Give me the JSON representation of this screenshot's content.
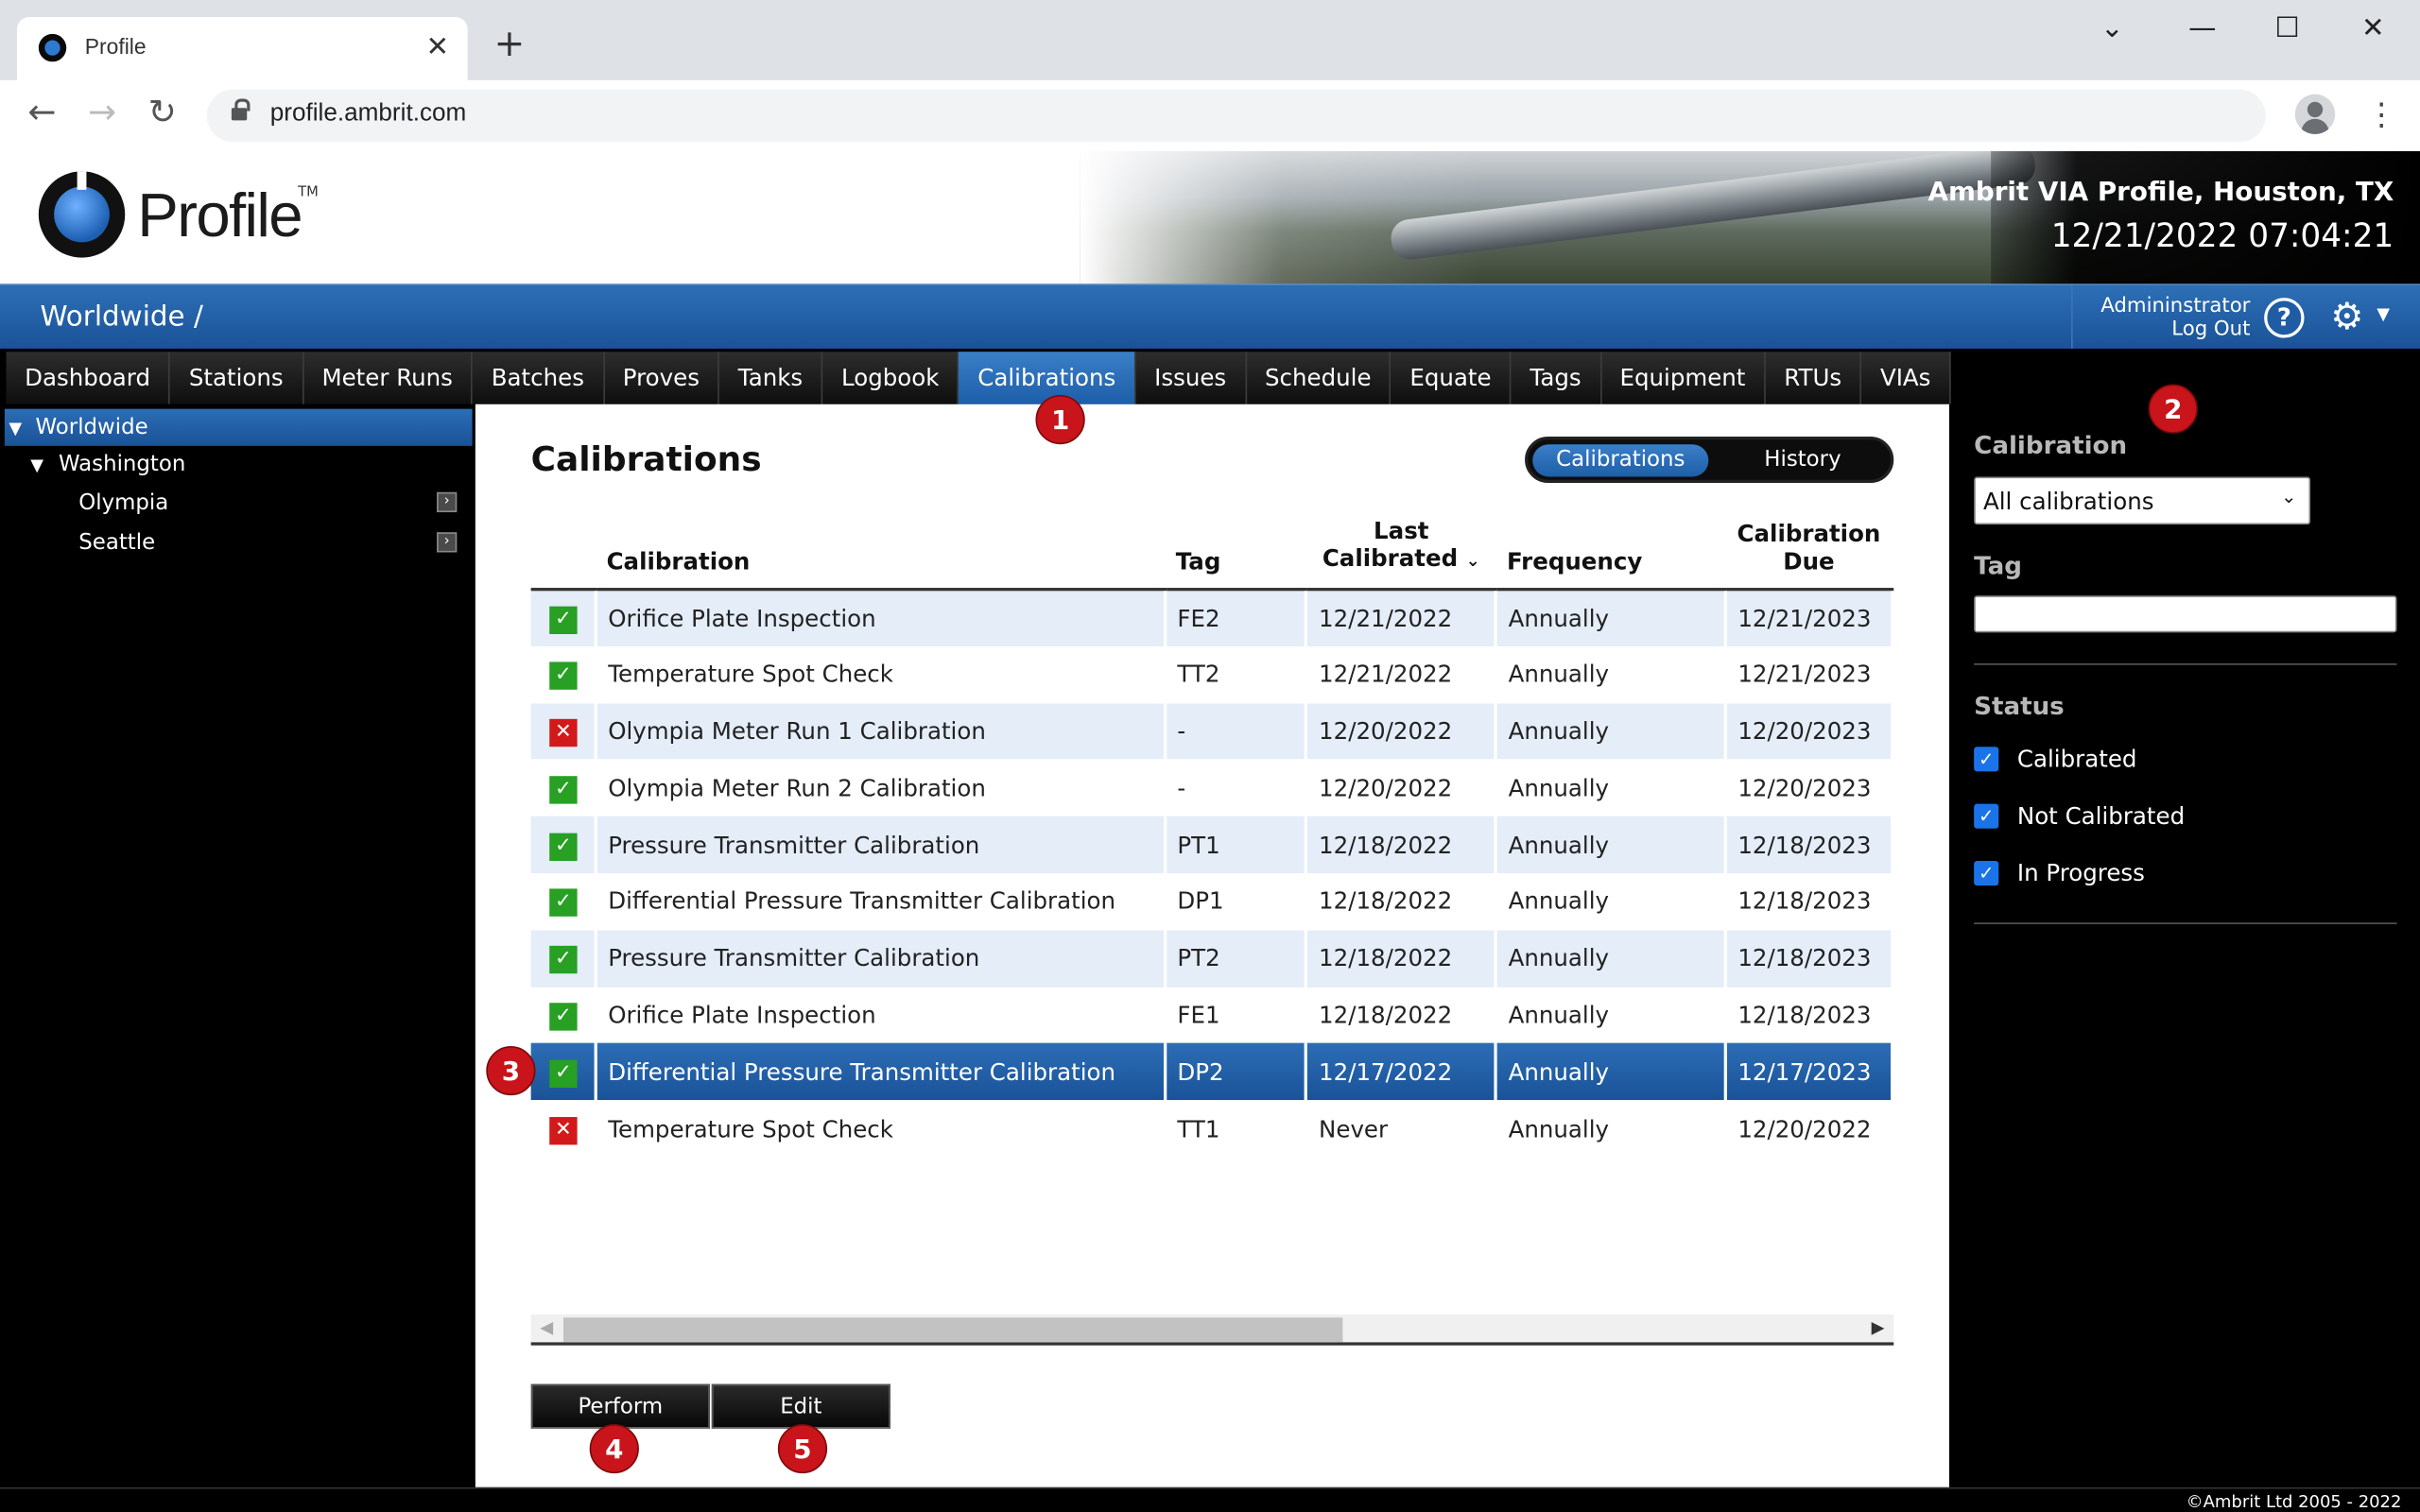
{
  "browser": {
    "tab_title": "Profile",
    "url": "profile.ambrit.com"
  },
  "header": {
    "logo_text": "Profile",
    "logo_tm": "TM",
    "site_name": "Ambrit VIA Profile, Houston, TX",
    "datetime": "12/21/2022 07:04:21"
  },
  "bluebar": {
    "breadcrumb": "Worldwide /",
    "user": "Admininstrator",
    "logout": "Log Out"
  },
  "nav": {
    "items": [
      "Dashboard",
      "Stations",
      "Meter Runs",
      "Batches",
      "Proves",
      "Tanks",
      "Logbook",
      "Calibrations",
      "Issues",
      "Schedule",
      "Equate",
      "Tags",
      "Equipment",
      "RTUs",
      "VIAs"
    ],
    "active": "Calibrations"
  },
  "tree": {
    "root": "Worldwide",
    "region": "Washington",
    "sites": [
      "Olympia",
      "Seattle"
    ]
  },
  "main": {
    "title": "Calibrations",
    "toggle": {
      "on": "Calibrations",
      "off": "History"
    },
    "columns": {
      "calibration": "Calibration",
      "tag": "Tag",
      "last_1": "Last",
      "last_2": "Calibrated",
      "frequency": "Frequency",
      "due_1": "Calibration",
      "due_2": "Due"
    },
    "rows": [
      {
        "status": "ok",
        "calibration": "Orifice Plate Inspection",
        "tag": "FE2",
        "last": "12/21/2022",
        "frequency": "Annually",
        "due": "12/21/2023"
      },
      {
        "status": "ok",
        "calibration": "Temperature Spot Check",
        "tag": "TT2",
        "last": "12/21/2022",
        "frequency": "Annually",
        "due": "12/21/2023"
      },
      {
        "status": "bad",
        "calibration": "Olympia Meter Run 1 Calibration",
        "tag": "-",
        "last": "12/20/2022",
        "frequency": "Annually",
        "due": "12/20/2023"
      },
      {
        "status": "ok",
        "calibration": "Olympia Meter Run 2 Calibration",
        "tag": "-",
        "last": "12/20/2022",
        "frequency": "Annually",
        "due": "12/20/2023"
      },
      {
        "status": "ok",
        "calibration": "Pressure Transmitter Calibration",
        "tag": "PT1",
        "last": "12/18/2022",
        "frequency": "Annually",
        "due": "12/18/2023"
      },
      {
        "status": "ok",
        "calibration": "Differential Pressure Transmitter Calibration",
        "tag": "DP1",
        "last": "12/18/2022",
        "frequency": "Annually",
        "due": "12/18/2023"
      },
      {
        "status": "ok",
        "calibration": "Pressure Transmitter Calibration",
        "tag": "PT2",
        "last": "12/18/2022",
        "frequency": "Annually",
        "due": "12/18/2023"
      },
      {
        "status": "ok",
        "calibration": "Orifice Plate Inspection",
        "tag": "FE1",
        "last": "12/18/2022",
        "frequency": "Annually",
        "due": "12/18/2023"
      },
      {
        "status": "ok",
        "calibration": "Differential Pressure Transmitter Calibration",
        "tag": "DP2",
        "last": "12/17/2022",
        "frequency": "Annually",
        "due": "12/17/2023",
        "selected": true
      },
      {
        "status": "bad",
        "calibration": "Temperature Spot Check",
        "tag": "TT1",
        "last": "Never",
        "frequency": "Annually",
        "due": "12/20/2022"
      }
    ],
    "buttons": {
      "perform": "Perform",
      "edit": "Edit"
    }
  },
  "filters": {
    "calibration_label": "Calibration",
    "calibration_value": "All calibrations",
    "tag_label": "Tag",
    "tag_value": "",
    "status_label": "Status",
    "statuses": [
      {
        "label": "Calibrated",
        "checked": true
      },
      {
        "label": "Not Calibrated",
        "checked": true
      },
      {
        "label": "In Progress",
        "checked": true
      }
    ]
  },
  "markers": [
    "1",
    "2",
    "3",
    "4",
    "5"
  ],
  "footer": {
    "copyright": "©Ambrit Ltd 2005 - 2022"
  },
  "colors": {
    "accent": "#1d5ea8",
    "ok": "#27a023",
    "bad": "#d21a1a",
    "marker": "#c8141a"
  }
}
